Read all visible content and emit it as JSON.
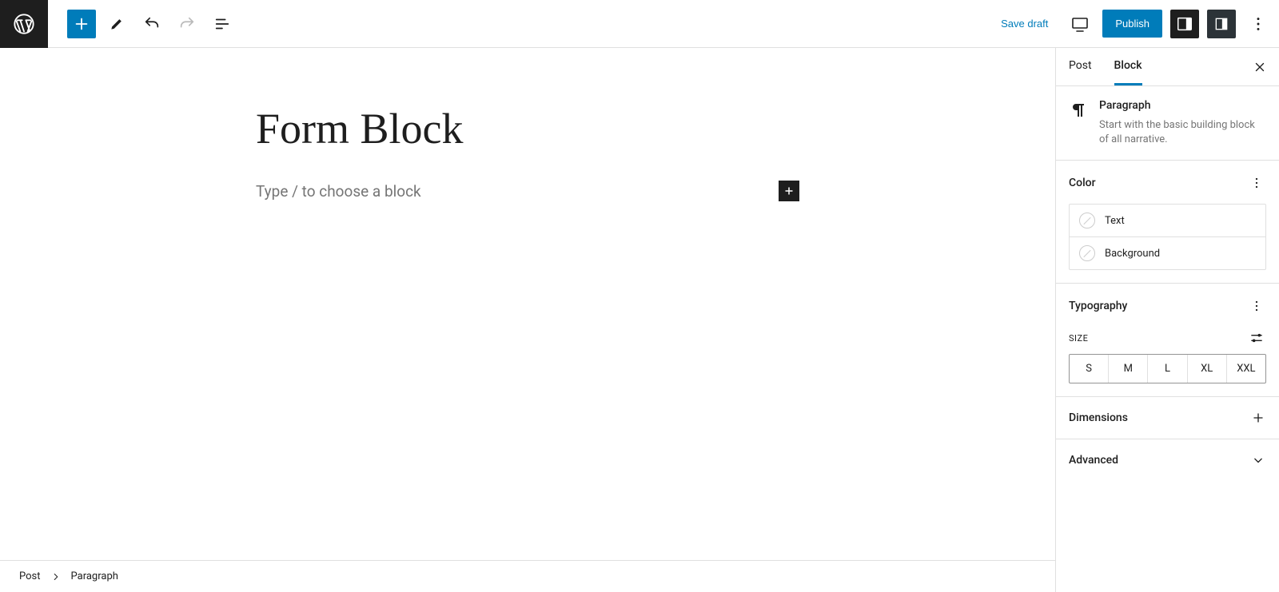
{
  "topbar": {
    "save_draft": "Save draft",
    "publish": "Publish"
  },
  "editor": {
    "title": "Form Block",
    "placeholder": "Type / to choose a block"
  },
  "sidebar": {
    "tabs": {
      "post": "Post",
      "block": "Block"
    },
    "block_info": {
      "title": "Paragraph",
      "desc": "Start with the basic building block of all narrative."
    },
    "color": {
      "heading": "Color",
      "text": "Text",
      "background": "Background"
    },
    "typography": {
      "heading": "Typography",
      "size_label": "SIZE",
      "sizes": [
        "S",
        "M",
        "L",
        "XL",
        "XXL"
      ]
    },
    "dimensions": {
      "heading": "Dimensions"
    },
    "advanced": {
      "heading": "Advanced"
    }
  },
  "breadcrumb": {
    "root": "Post",
    "current": "Paragraph"
  }
}
